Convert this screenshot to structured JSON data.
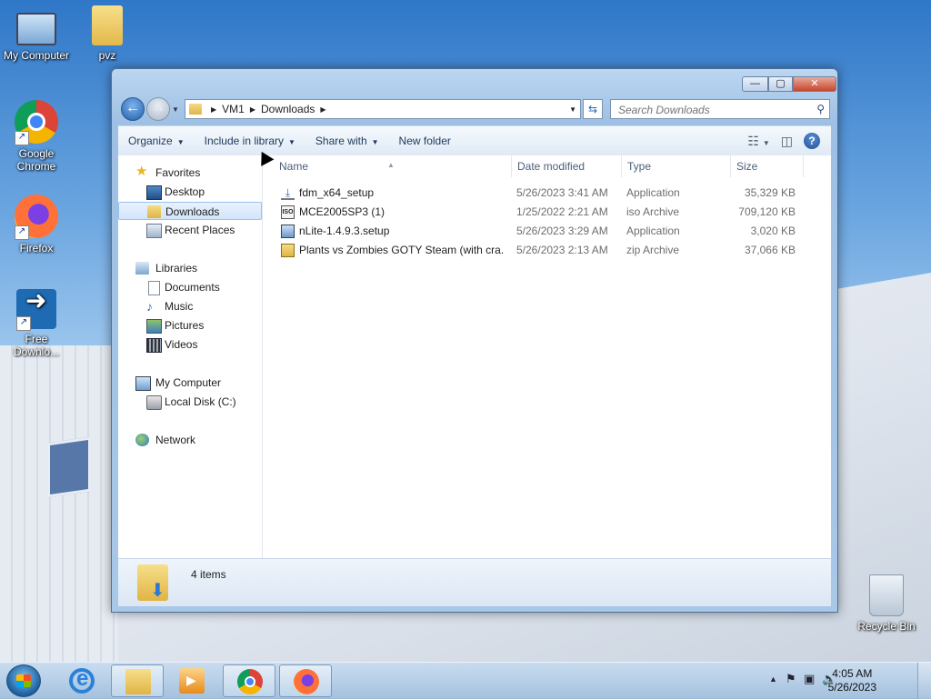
{
  "desktop": {
    "icons": [
      {
        "label": "My Computer"
      },
      {
        "label": "pvz"
      },
      {
        "label": "Google Chrome"
      },
      {
        "label": "Firefox"
      },
      {
        "label": "Free Downlo..."
      },
      {
        "label": "Recycle Bin"
      }
    ]
  },
  "window": {
    "controls": {
      "minimize": "—",
      "maximize": "▢",
      "close": "✕"
    },
    "address": {
      "crumbs": [
        "VM1",
        "Downloads"
      ]
    },
    "search": {
      "placeholder": "Search Downloads"
    },
    "toolbar": {
      "organize": "Organize",
      "include_in_library": "Include in library",
      "share_with": "Share with",
      "new_folder": "New folder"
    },
    "nav": {
      "favorites": "Favorites",
      "desktop": "Desktop",
      "downloads": "Downloads",
      "recent_places": "Recent Places",
      "libraries": "Libraries",
      "documents": "Documents",
      "music": "Music",
      "pictures": "Pictures",
      "videos": "Videos",
      "my_computer": "My Computer",
      "local_disk": "Local Disk (C:)",
      "network": "Network"
    },
    "columns": {
      "name": "Name",
      "date": "Date modified",
      "type": "Type",
      "size": "Size"
    },
    "files": [
      {
        "name": "fdm_x64_setup",
        "date": "5/26/2023 3:41 AM",
        "type": "Application",
        "size": "35,329 KB"
      },
      {
        "name": "MCE2005SP3 (1)",
        "date": "1/25/2022 2:21 AM",
        "type": "iso Archive",
        "size": "709,120 KB"
      },
      {
        "name": "nLite-1.4.9.3.setup",
        "date": "5/26/2023 3:29 AM",
        "type": "Application",
        "size": "3,020 KB"
      },
      {
        "name": "Plants vs Zombies GOTY Steam (with cra...",
        "date": "5/26/2023 2:13 AM",
        "type": "zip Archive",
        "size": "37,066 KB"
      }
    ],
    "details": {
      "count": "4 items"
    }
  },
  "taskbar": {
    "time": "4:05 AM",
    "date": "5/26/2023"
  }
}
